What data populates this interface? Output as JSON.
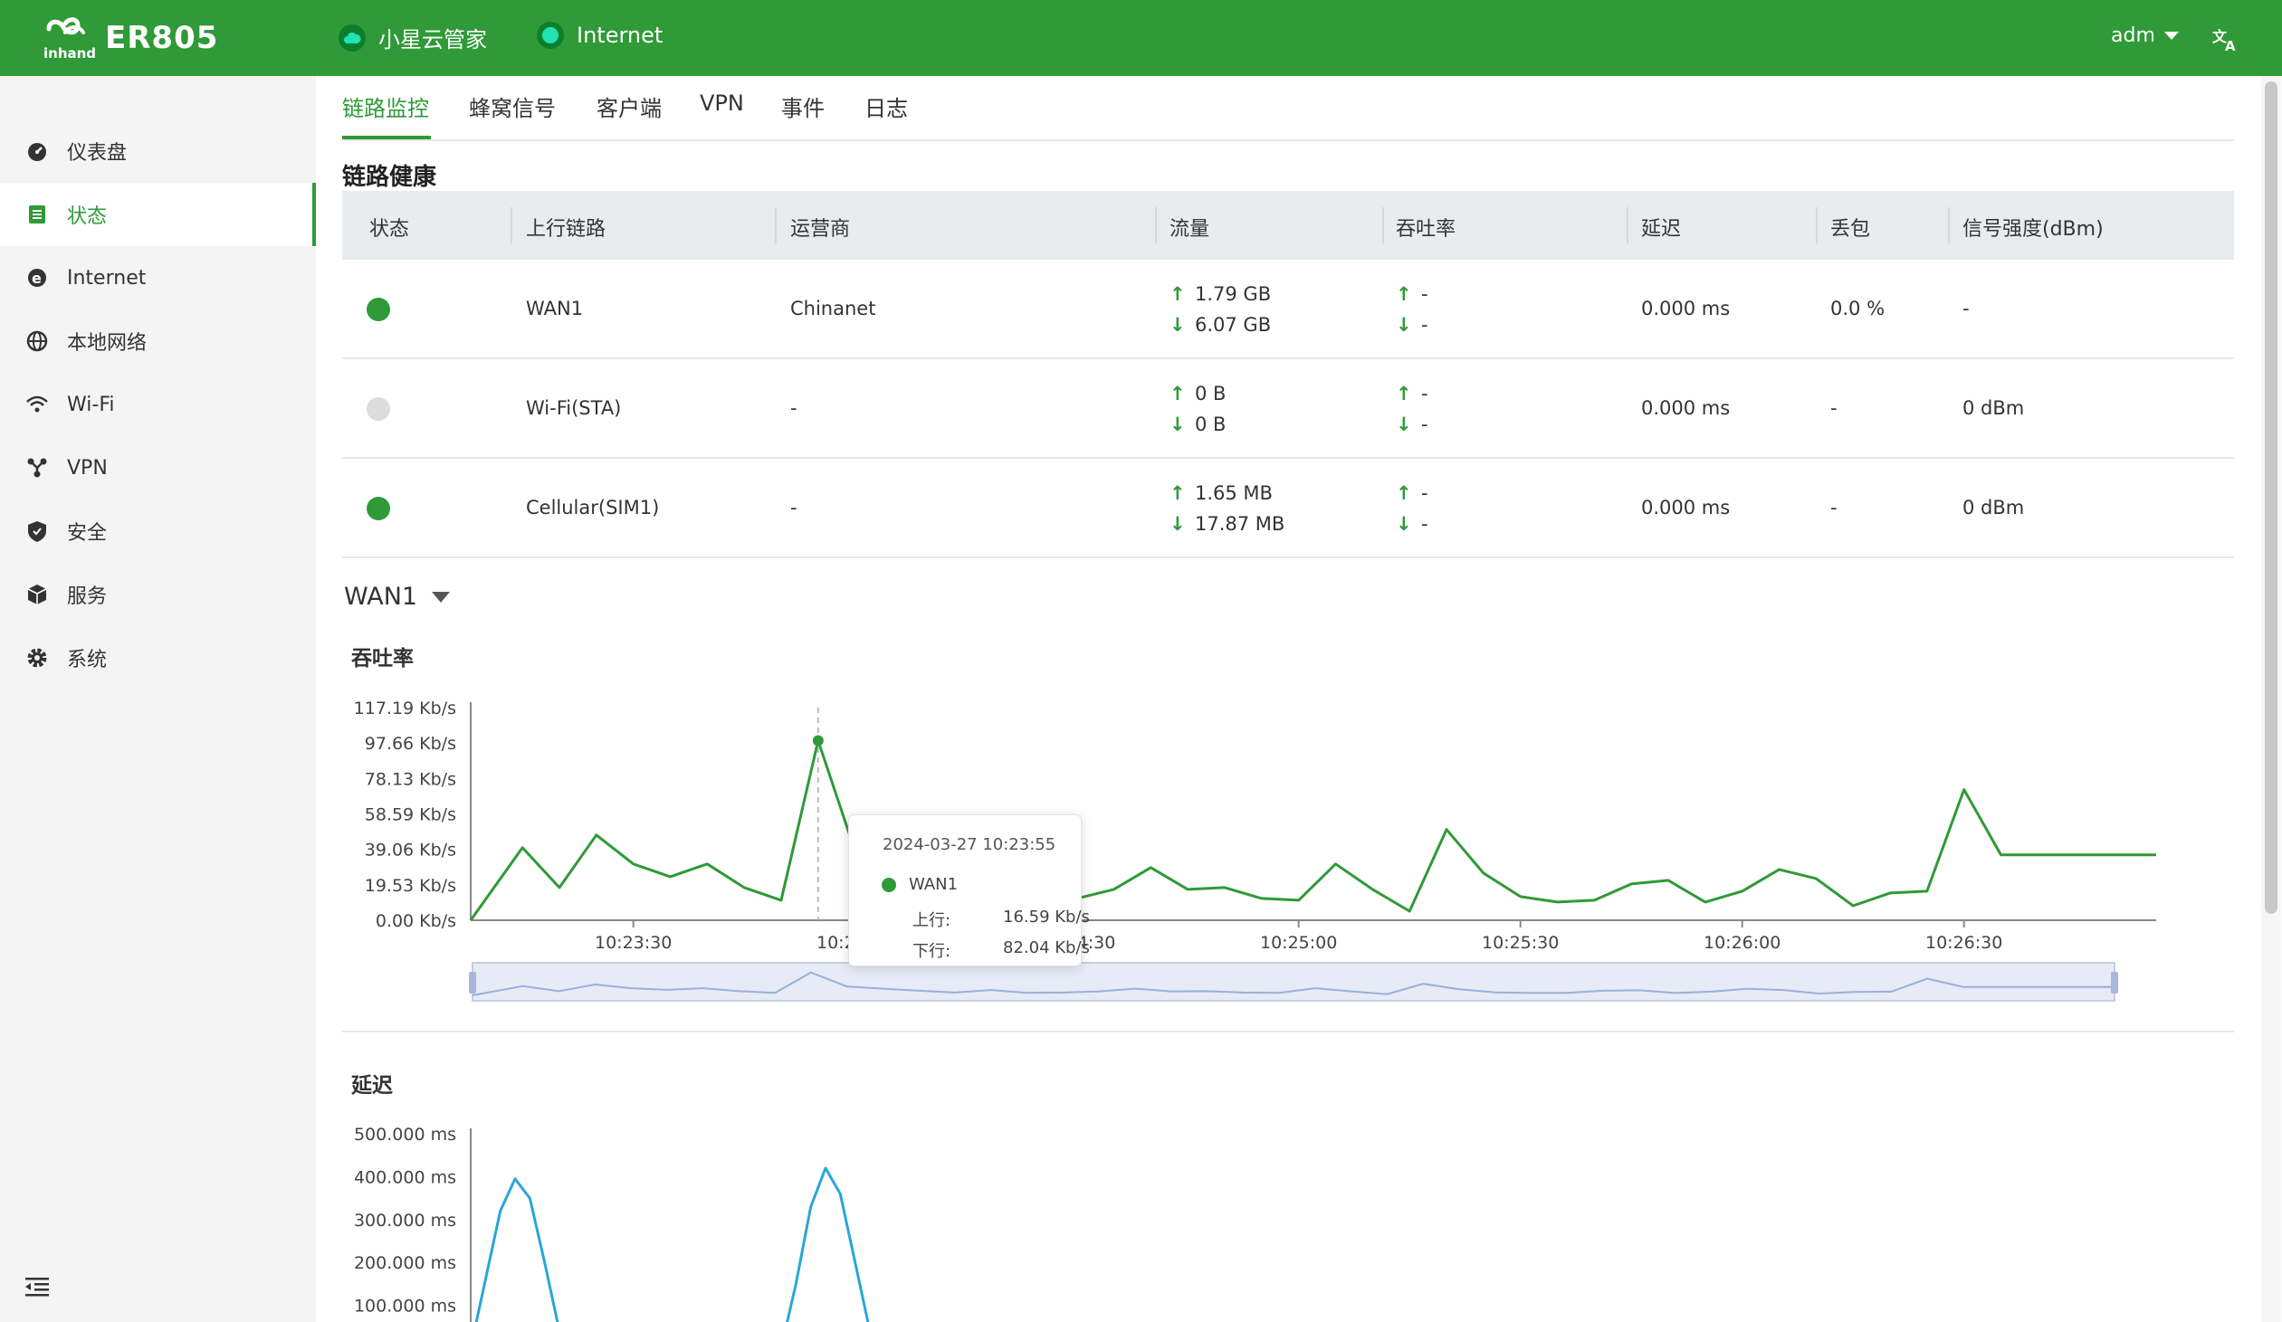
{
  "header": {
    "brand": "ER805",
    "cloud_label": "小星云管家",
    "internet_label": "Internet",
    "user": "adm",
    "colors": {
      "brand_green": "#2f9a37",
      "status_teal": "#22e2b4"
    }
  },
  "sidebar": {
    "items": [
      {
        "label": "仪表盘",
        "icon": "dashboard-icon"
      },
      {
        "label": "状态",
        "icon": "status-list-icon",
        "active": true
      },
      {
        "label": "Internet",
        "icon": "internet-icon"
      },
      {
        "label": "本地网络",
        "icon": "globe-icon"
      },
      {
        "label": "Wi-Fi",
        "icon": "wifi-icon"
      },
      {
        "label": "VPN",
        "icon": "vpn-icon"
      },
      {
        "label": "安全",
        "icon": "shield-icon"
      },
      {
        "label": "服务",
        "icon": "cube-icon"
      },
      {
        "label": "系统",
        "icon": "gear-icon"
      }
    ]
  },
  "tabs": [
    "链路监控",
    "蜂窝信号",
    "客户端",
    "VPN",
    "事件",
    "日志"
  ],
  "link_health": {
    "title": "链路健康",
    "columns": [
      "状态",
      "上行链路",
      "运营商",
      "流量",
      "吞吐率",
      "延迟",
      "丢包",
      "信号强度(dBm)"
    ],
    "rows": [
      {
        "status_color": "#2f9a37",
        "uplink": "WAN1",
        "carrier": "Chinanet",
        "traffic_up": "1.79 GB",
        "traffic_down": "6.07 GB",
        "thr_up": "-",
        "thr_down": "-",
        "latency": "0.000 ms",
        "loss": "0.0 %",
        "signal": "-"
      },
      {
        "status_color": "#dcdcdc",
        "uplink": "Wi-Fi(STA)",
        "carrier": "-",
        "traffic_up": "0 B",
        "traffic_down": "0 B",
        "thr_up": "-",
        "thr_down": "-",
        "latency": "0.000 ms",
        "loss": "-",
        "signal": "0 dBm"
      },
      {
        "status_color": "#2f9a37",
        "uplink": "Cellular(SIM1)",
        "carrier": "-",
        "traffic_up": "1.65 MB",
        "traffic_down": "17.87 MB",
        "thr_up": "-",
        "thr_down": "-",
        "latency": "0.000 ms",
        "loss": "-",
        "signal": "0 dBm"
      }
    ]
  },
  "selector": {
    "value": "WAN1"
  },
  "throughput_title": "吞吐率",
  "latency_title": "延迟",
  "tooltip": {
    "time": "2024-03-27 10:23:55",
    "series": "WAN1",
    "up_label": "上行:",
    "up_value": "16.59 Kb/s",
    "down_label": "下行:",
    "down_value": "82.04 Kb/s"
  },
  "chart_data": [
    {
      "type": "line",
      "title": "吞吐率",
      "y_ticks": [
        "0.00 Kb/s",
        "19.53 Kb/s",
        "39.06 Kb/s",
        "58.59 Kb/s",
        "78.13 Kb/s",
        "97.66 Kb/s",
        "117.19 Kb/s"
      ],
      "ylim": [
        0,
        117.19
      ],
      "x_ticks": [
        "10:23:30",
        "10:24:00",
        "10:24:30",
        "10:25:00",
        "10:25:30",
        "10:26:00",
        "10:26:30"
      ],
      "x_tick_seconds": [
        30,
        60,
        90,
        120,
        150,
        180,
        210
      ],
      "xlim_seconds": [
        8,
        236
      ],
      "series": [
        {
          "color": "#2f9a37",
          "x_seconds": [
            8,
            15,
            20,
            25,
            30,
            35,
            40,
            45,
            50,
            55,
            60,
            65,
            70,
            75,
            80,
            85,
            90,
            95,
            100,
            105,
            110,
            115,
            120,
            125,
            130,
            135,
            140,
            145,
            150,
            155,
            160,
            165,
            170,
            175,
            180,
            185,
            190,
            195,
            200,
            205,
            210,
            215,
            220,
            225,
            230,
            236
          ],
          "values": [
            0,
            40,
            18,
            47,
            31,
            24,
            31,
            18,
            11,
            99,
            38,
            29,
            20,
            12,
            23,
            11,
            12,
            17,
            29,
            17,
            18,
            12,
            11,
            31,
            17,
            5,
            50,
            26,
            13,
            10,
            11,
            20,
            22,
            10,
            16,
            28,
            23,
            8,
            15,
            16,
            72,
            36,
            36,
            36,
            36,
            36
          ]
        }
      ]
    },
    {
      "type": "line",
      "title": "延迟",
      "y_ticks": [
        "100.000 ms",
        "200.000 ms",
        "300.000 ms",
        "400.000 ms",
        "500.000 ms"
      ],
      "ylim": [
        0,
        500
      ],
      "x_seconds": [
        8,
        10,
        12,
        14,
        16,
        18,
        20,
        22,
        50,
        52,
        54,
        56,
        58,
        60,
        62,
        64
      ],
      "series": [
        {
          "color": "#2aa6d8",
          "values": [
            0,
            160,
            320,
            395,
            350,
            200,
            40,
            0,
            0,
            150,
            330,
            420,
            360,
            200,
            40,
            0
          ]
        }
      ]
    }
  ]
}
